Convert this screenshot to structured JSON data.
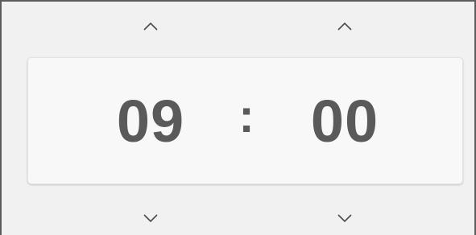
{
  "time_picker": {
    "hours": "09",
    "separator": ":",
    "minutes": "00"
  },
  "icons": {
    "increment": "chevron-up-icon",
    "decrement": "chevron-down-icon"
  },
  "colors": {
    "background": "#f1f1f1",
    "display_background": "#f8f8f8",
    "digit_color": "#5a5a5a",
    "arrow_color": "#4a4a4a",
    "frame_border": "#5c5c5c"
  }
}
